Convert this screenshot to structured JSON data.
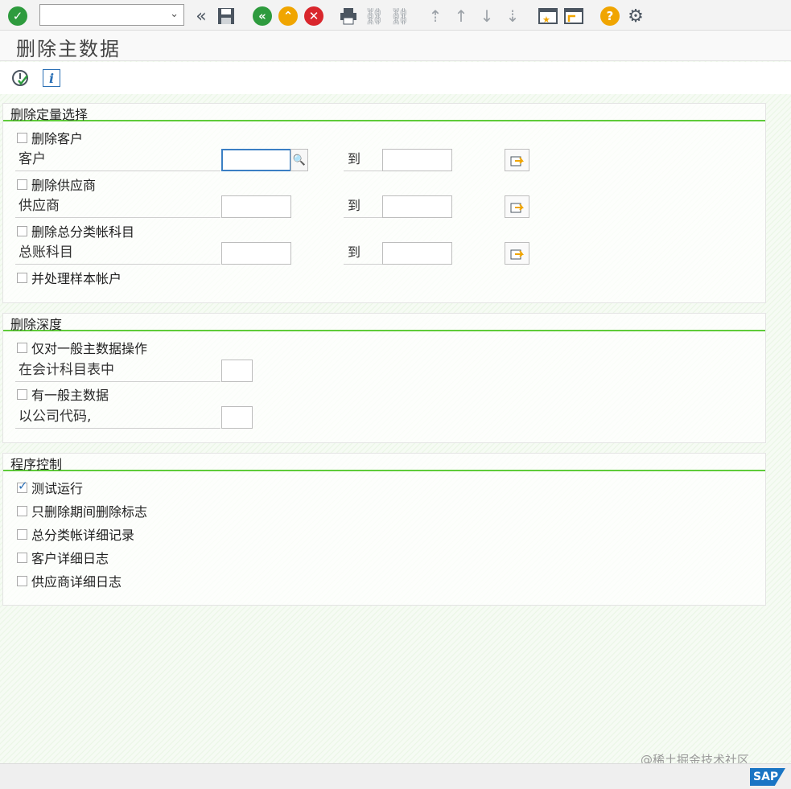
{
  "toolbar": {
    "command_field": {
      "value": "",
      "placeholder": ""
    },
    "icons": [
      "enter-icon",
      "save-icon",
      "back-icon",
      "exit-icon",
      "cancel-icon",
      "print-icon",
      "find-icon",
      "find-next-icon",
      "first-page-icon",
      "previous-page-icon",
      "next-page-icon",
      "last-page-icon",
      "create-session-icon",
      "shortcut-icon",
      "help-icon",
      "settings-icon"
    ]
  },
  "page": {
    "title": "删除主数据"
  },
  "appbar": {
    "icons": [
      "execute-icon",
      "info-icon"
    ],
    "info_glyph": "i"
  },
  "groups": {
    "selection": {
      "title": "删除定量选择",
      "delete_customer": {
        "label": "删除客户",
        "checked": false
      },
      "customer": {
        "label": "客户",
        "from": "",
        "to_label": "到",
        "to": ""
      },
      "delete_vendor": {
        "label": "删除供应商",
        "checked": false
      },
      "vendor": {
        "label": "供应商",
        "from": "",
        "to_label": "到",
        "to": ""
      },
      "delete_gl": {
        "label": "删除总分类帐科目",
        "checked": false
      },
      "gl": {
        "label": "总账科目",
        "from": "",
        "to_label": "到",
        "to": ""
      },
      "sample": {
        "label": "并处理样本帐户",
        "checked": false
      }
    },
    "depth": {
      "title": "删除深度",
      "general_only": {
        "label": "仅对一般主数据操作",
        "checked": false
      },
      "in_coa": {
        "label": "在会计科目表中",
        "value": ""
      },
      "with_general": {
        "label": "有一般主数据",
        "checked": false
      },
      "company_code": {
        "label": "以公司代码,",
        "value": ""
      }
    },
    "control": {
      "title": "程序控制",
      "items": [
        {
          "label": "测试运行",
          "checked": true
        },
        {
          "label": "只删除期间删除标志",
          "checked": false
        },
        {
          "label": "总分类帐详细记录",
          "checked": false
        },
        {
          "label": "客户详细日志",
          "checked": false
        },
        {
          "label": "供应商详细日志",
          "checked": false
        }
      ]
    }
  },
  "footer": {
    "watermark": "@稀土掘金技术社区",
    "logo": "SAP"
  },
  "colors": {
    "accent_green": "#5fcb3a",
    "focus_blue": "#3b7fc4",
    "ok_green": "#2e9b3e",
    "warn_orange": "#f0a500",
    "cancel_red": "#d9262c"
  }
}
